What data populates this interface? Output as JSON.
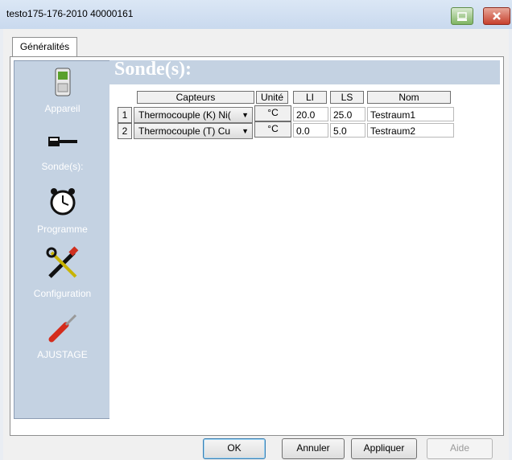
{
  "window": {
    "title": "testo175-176-2010 40000161"
  },
  "tabs": [
    {
      "label": "Généralités"
    }
  ],
  "sidebar": {
    "items": [
      {
        "label": "Appareil",
        "icon": "device-icon"
      },
      {
        "label": "Sonde(s):",
        "icon": "probe-icon"
      },
      {
        "label": "Programme",
        "icon": "clock-icon"
      },
      {
        "label": "Configuration",
        "icon": "tools-icon"
      },
      {
        "label": "AJUSTAGE",
        "icon": "screwdriver-icon"
      }
    ]
  },
  "section": {
    "title": "Sonde(s):"
  },
  "table": {
    "headers": [
      "Capteurs",
      "Unité",
      "LI",
      "LS",
      "Nom"
    ],
    "rows": [
      {
        "num": "1",
        "sensor": "Thermocouple (K) Ni(",
        "unit": "°C",
        "li": "20.0",
        "ls": "25.0",
        "name": "Testraum1"
      },
      {
        "num": "2",
        "sensor": "Thermocouple (T) Cu",
        "unit": "°C",
        "li": "0.0",
        "ls": "5.0",
        "name": "Testraum2"
      }
    ]
  },
  "buttons": {
    "ok": "OK",
    "cancel": "Annuler",
    "apply": "Appliquer",
    "help": "Aide"
  },
  "colors": {
    "sidebar": "#c4d2e2",
    "header": "#c4d2e2",
    "close": "#c7402d"
  }
}
